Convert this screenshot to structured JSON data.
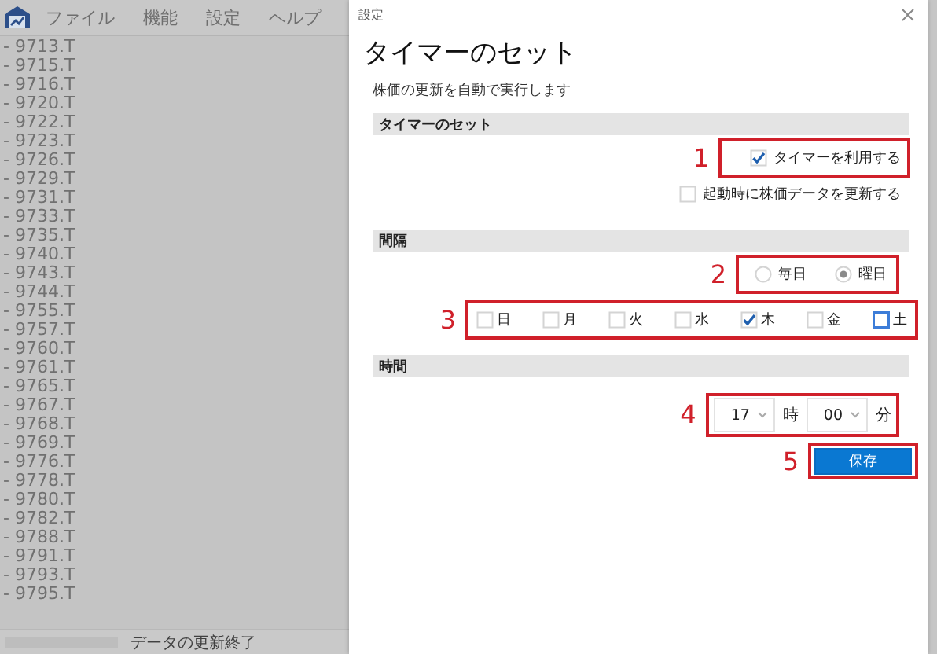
{
  "app": {
    "menu": [
      "ファイル",
      "機能",
      "設定",
      "ヘルプ"
    ],
    "list": [
      "- 9713.T",
      "- 9715.T",
      "- 9716.T",
      "- 9720.T",
      "- 9722.T",
      "- 9723.T",
      "- 9726.T",
      "- 9729.T",
      "- 9731.T",
      "- 9733.T",
      "- 9735.T",
      "- 9740.T",
      "- 9743.T",
      "- 9744.T",
      "- 9755.T",
      "- 9757.T",
      "- 9760.T",
      "- 9761.T",
      "- 9765.T",
      "- 9767.T",
      "- 9768.T",
      "- 9769.T",
      "- 9776.T",
      "- 9778.T",
      "- 9780.T",
      "- 9782.T",
      "- 9788.T",
      "- 9791.T",
      "- 9793.T",
      "- 9795.T"
    ],
    "status": {
      "level": 1,
      "text": "データの更新終了"
    }
  },
  "dialog": {
    "title": "設定",
    "heading": "タイマーのセット",
    "description": "株価の更新を自動で実行します",
    "timer_section": {
      "title": "タイマーのセット",
      "annotation": "1",
      "options": [
        {
          "label": "タイマーを利用する",
          "checked": true
        },
        {
          "label": "起動時に株価データを更新する",
          "checked": false
        }
      ]
    },
    "interval_section": {
      "title": "間隔",
      "mode_annotation": "2",
      "modes": [
        {
          "label": "毎日",
          "selected": false
        },
        {
          "label": "曜日",
          "selected": true
        }
      ],
      "days_annotation": "3",
      "days": [
        {
          "label": "日",
          "checked": false,
          "focused": false
        },
        {
          "label": "月",
          "checked": false,
          "focused": false
        },
        {
          "label": "火",
          "checked": false,
          "focused": false
        },
        {
          "label": "水",
          "checked": false,
          "focused": false
        },
        {
          "label": "木",
          "checked": true,
          "focused": false
        },
        {
          "label": "金",
          "checked": false,
          "focused": false
        },
        {
          "label": "土",
          "checked": false,
          "focused": true
        }
      ]
    },
    "time_section": {
      "title": "時間",
      "annotation": "4",
      "hour": "17",
      "hour_unit": "時",
      "minute": "00",
      "minute_unit": "分"
    },
    "save_button": {
      "label": "保存",
      "annotation": "5"
    }
  }
}
